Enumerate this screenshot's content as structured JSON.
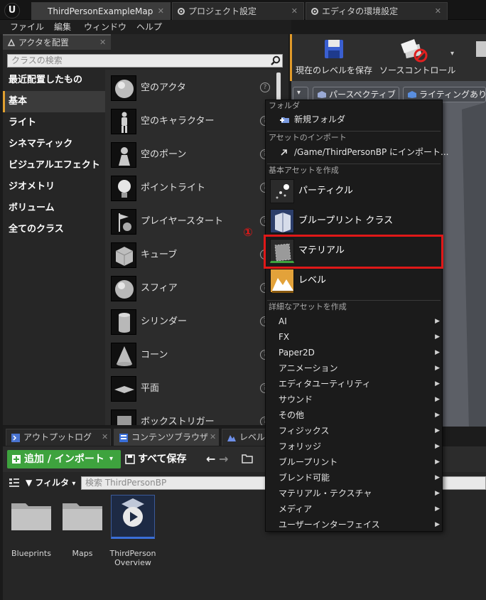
{
  "tabs": [
    {
      "label": "ThirdPersonExampleMap",
      "active": true
    },
    {
      "label": "プロジェクト設定",
      "active": false
    },
    {
      "label": "エディタの環境設定",
      "active": false
    }
  ],
  "menu": [
    "ファイル",
    "編集",
    "ウィンドウ",
    "ヘルプ"
  ],
  "place_actors": {
    "tab_label": "アクタを配置",
    "search_placeholder": "クラスの検索",
    "categories": [
      "最近配置したもの",
      "基本",
      "ライト",
      "シネマティック",
      "ビジュアルエフェクト",
      "ジオメトリ",
      "ボリューム",
      "全てのクラス"
    ],
    "selected_category": "基本",
    "actors": [
      "空のアクタ",
      "空のキャラクター",
      "空のポーン",
      "ポイントライト",
      "プレイヤースタート",
      "キューブ",
      "スフィア",
      "シリンダー",
      "コーン",
      "平面",
      "ボックストリガー"
    ]
  },
  "toolbar": {
    "save_label": "現在のレベルを保存",
    "source_control_label": "ソースコントロール"
  },
  "viewport": {
    "perspective_label": "パースペクティブ",
    "lighting_label": "ライティングあり"
  },
  "bottom_tabs": [
    {
      "label": "アウトプットログ",
      "active": false
    },
    {
      "label": "コンテンツブラウザ",
      "active": true
    },
    {
      "label": "レベル",
      "active": false
    }
  ],
  "content_browser": {
    "add_import_label": "追加 / インポート",
    "save_all_label": "すべて保存",
    "filter_label": "フィルタ",
    "search_placeholder": "検索 ThirdPersonBP",
    "assets": [
      "Blueprints",
      "Maps",
      "ThirdPerson Overview"
    ]
  },
  "context_menu": {
    "folder_header": "フォルダ",
    "new_folder": "新規フォルダ",
    "import_header": "アセットのインポート",
    "import_item": "/Game/ThirdPersonBP にインポート...",
    "basic_header": "基本アセットを作成",
    "basic_items": [
      "パーティクル",
      "ブループリント クラス",
      "マテリアル",
      "レベル"
    ],
    "advanced_header": "詳細なアセットを作成",
    "advanced_items": [
      "AI",
      "FX",
      "Paper2D",
      "アニメーション",
      "エディタユーティリティ",
      "サウンド",
      "その他",
      "フィジックス",
      "フォリッジ",
      "ブループリント",
      "ブレンド可能",
      "マテリアル・テクスチャ",
      "メディア",
      "ユーザーインターフェイス"
    ]
  },
  "annotation": {
    "step_marker": "①",
    "highlight_color": "#e01818"
  }
}
